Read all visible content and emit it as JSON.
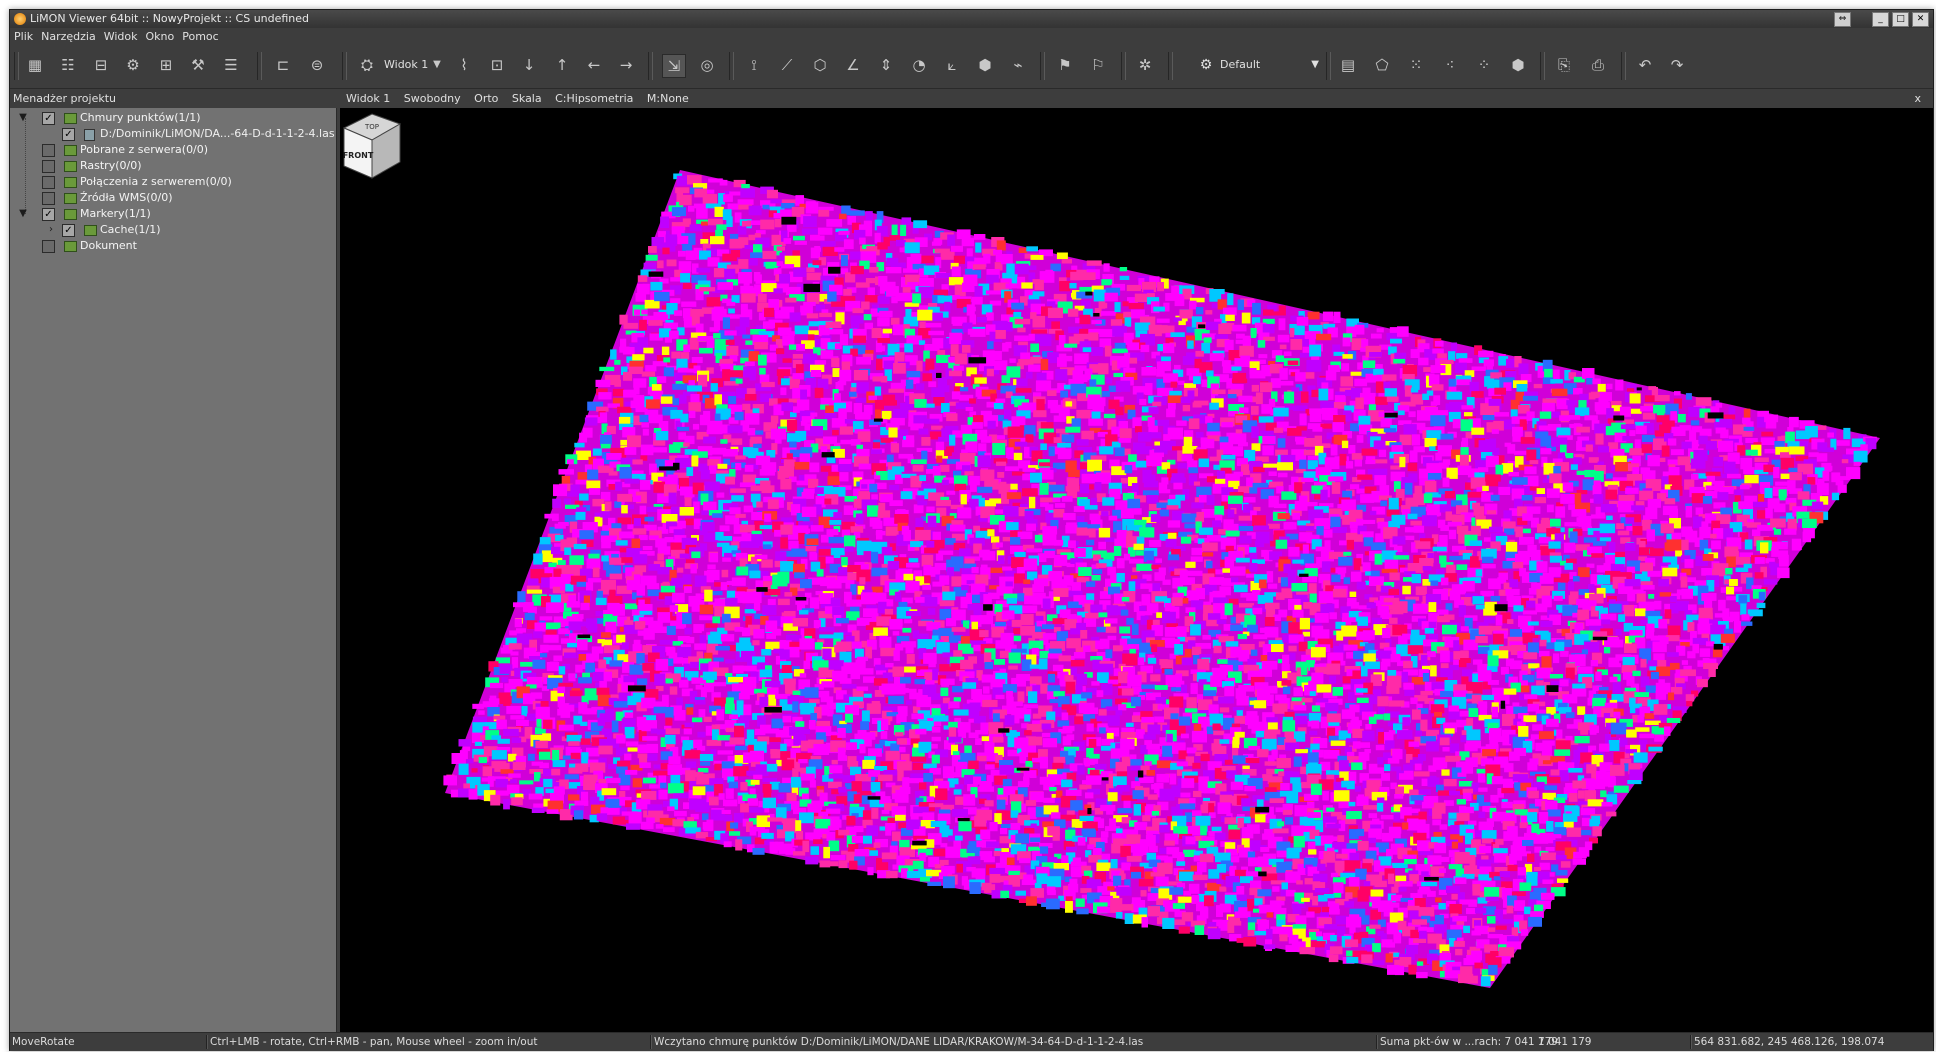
{
  "window": {
    "title": "LiMON Viewer 64bit :: NowyProjekt :: CS undefined"
  },
  "menu": [
    "Plik",
    "Narzędzia",
    "Widok",
    "Okno",
    "Pomoc"
  ],
  "toolbar": {
    "view_label": "Widok 1",
    "style_value": "Default"
  },
  "project_panel": {
    "title": "Menadżer projektu",
    "tree": [
      {
        "label": "Chmury punktów(1/1)",
        "checked": true,
        "expanded": true
      },
      {
        "label": "D:/Dominik/LiMON/DA...-64-D-d-1-1-2-4.las",
        "checked": true
      },
      {
        "label": "Pobrane z serwera(0/0)",
        "checked": false
      },
      {
        "label": "Rastry(0/0)",
        "checked": false
      },
      {
        "label": "Połączenia z serwerem(0/0)",
        "checked": false
      },
      {
        "label": "Źródła WMS(0/0)",
        "checked": false
      },
      {
        "label": "Markery(1/1)",
        "checked": true,
        "expanded": true
      },
      {
        "label": "Cache(1/1)",
        "checked": true
      },
      {
        "label": "Dokument",
        "checked": false
      }
    ]
  },
  "view_header": {
    "items": [
      "Widok 1",
      "Swobodny",
      "Orto",
      "Skala",
      "C:Hipsometria",
      "M:None"
    ],
    "close": "x"
  },
  "navcube": {
    "top": "TOP",
    "front": "FRONT"
  },
  "statusbar": {
    "mode": "MoveRotate",
    "hint": "Ctrl+LMB - rotate, Ctrl+RMB - pan, Mouse wheel - zoom in/out",
    "message": "Wczytano chmurę punktów D:/Dominik/LiMON/DANE LIDAR/KRAKOW/M-34-64-D-d-1-1-2-4.las",
    "points_label": "Suma pkt-ów w ...rach: 7 041 179",
    "points_value": "7 041 179",
    "coords": "564 831.682, 245 468.126, 198.074"
  },
  "colors": {
    "pointcloud": [
      "#ff00ff",
      "#ff2aa8",
      "#c000ff",
      "#ff0066",
      "#00c8ff",
      "#2a6bff",
      "#00ff88",
      "#ffff00",
      "#ff3030"
    ]
  }
}
